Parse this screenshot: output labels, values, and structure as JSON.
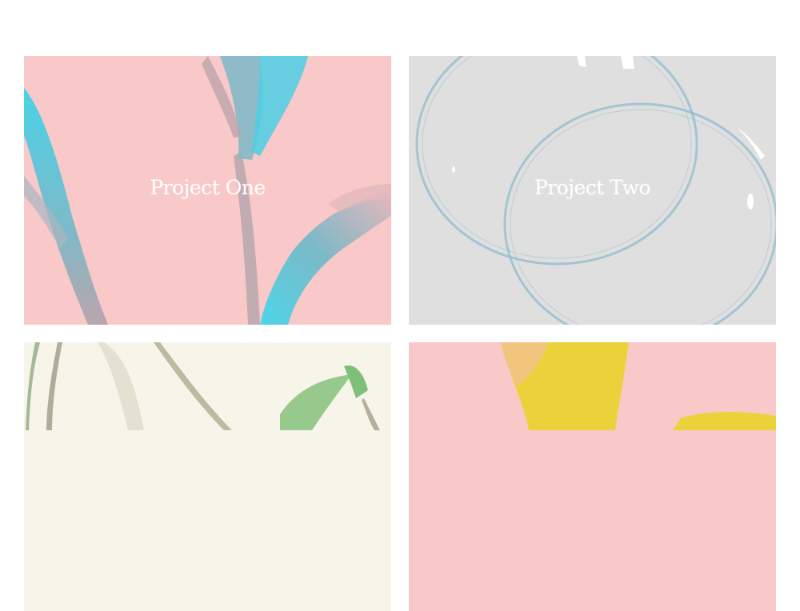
{
  "projects": [
    {
      "title": "Project One",
      "background": "#f9c8c8",
      "accent": "#3ecfe6"
    },
    {
      "title": "Project Two",
      "background": "#dfdfdf",
      "accent": "#7fb6c9"
    },
    {
      "title": "",
      "background": "#f7f4ea",
      "accent": "#7ec07a"
    },
    {
      "title": "",
      "background": "#f9c8c8",
      "accent": "#ecd23a"
    }
  ]
}
